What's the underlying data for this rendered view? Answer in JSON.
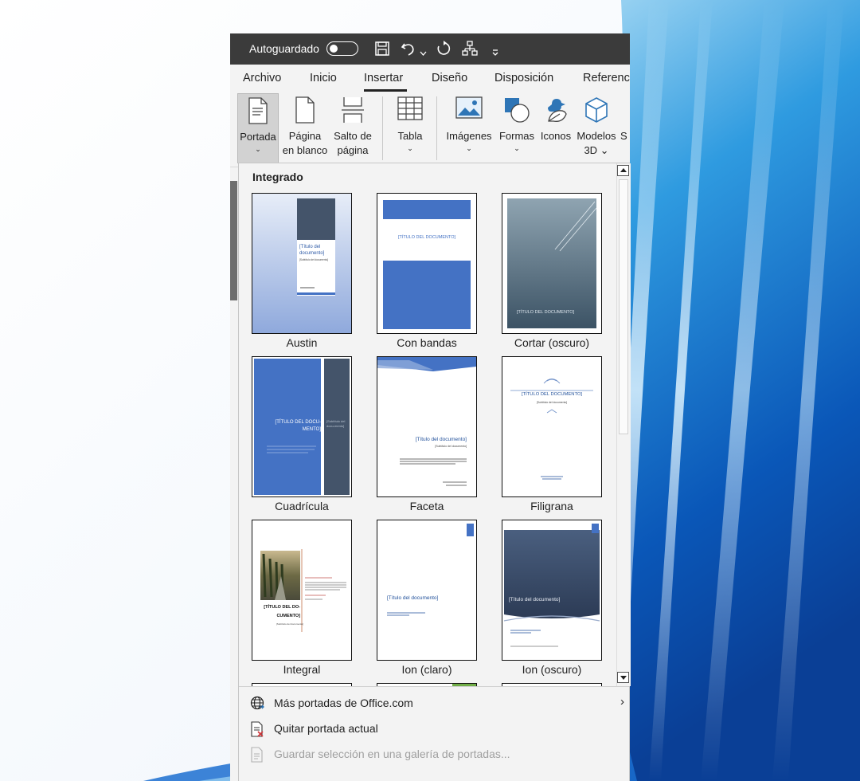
{
  "title_bar": {
    "autosave_label": "Autoguardado",
    "icons": [
      "save-icon",
      "undo-icon",
      "redo-icon",
      "org-chart-icon",
      "customize-qat-icon"
    ]
  },
  "tabs": [
    {
      "label": "Archivo"
    },
    {
      "label": "Inicio"
    },
    {
      "label": "Insertar",
      "active": true
    },
    {
      "label": "Diseño"
    },
    {
      "label": "Disposición"
    },
    {
      "label": "Referenc"
    }
  ],
  "ribbon": {
    "portada": {
      "line1": "Portada",
      "caret": "⌄"
    },
    "pagina_blanco": {
      "line1": "Página",
      "line2": "en blanco"
    },
    "salto_pagina": {
      "line1": "Salto de",
      "line2": "página"
    },
    "tabla": {
      "line1": "Tabla",
      "caret": "⌄"
    },
    "imagenes": {
      "line1": "Imágenes",
      "caret": "⌄"
    },
    "formas": {
      "line1": "Formas",
      "caret": "⌄"
    },
    "iconos": {
      "line1": "Iconos"
    },
    "modelos3d": {
      "line1": "Modelos",
      "line2": "3D ⌄"
    },
    "cut_off": {
      "line1": "S"
    }
  },
  "gallery": {
    "heading": "Integrado",
    "items": [
      {
        "name": "Austin",
        "title_text": "[Título del documento]",
        "subtitle_text": "[Subtítulo del documento]"
      },
      {
        "name": "Con bandas",
        "title_text": "[TÍTULO DEL DOCUMENTO]"
      },
      {
        "name": "Cortar (oscuro)",
        "title_text": "[TÍTULO DEL DOCUMENTO]"
      },
      {
        "name": "Cuadrícula",
        "title_text": "[TÍTULO DEL DOCU-MENTO]",
        "subtitle_text": "[Subtítulo del docu-mento]"
      },
      {
        "name": "Faceta",
        "title_text": "[Título del documento]",
        "subtitle_text": "[Subtítulo del documento]"
      },
      {
        "name": "Filigrana",
        "title_text": "[TÍTULO DEL DOCUMENTO]",
        "subtitle_text": "[Subtítulo del documento]"
      },
      {
        "name": "Integral",
        "title_text": "[TÍTULO DEL DO-CUMENTO]",
        "subtitle_text": "[Subtítulo del documento]"
      },
      {
        "name": "Ion (claro)",
        "title_text": "[Título del documento]"
      },
      {
        "name": "Ion (oscuro)",
        "title_text": "[Título del documento]"
      }
    ]
  },
  "menu": {
    "more_covers": "Más portadas de Office.com",
    "remove_cover": "Quitar portada actual",
    "save_selection": "Guardar selección en una galería de portadas..."
  },
  "colors": {
    "accent_blue": "#4472c4",
    "dark_slate": "#44546a",
    "title_bar": "#3b3b3b",
    "panel_bg": "#f3f3f3"
  }
}
